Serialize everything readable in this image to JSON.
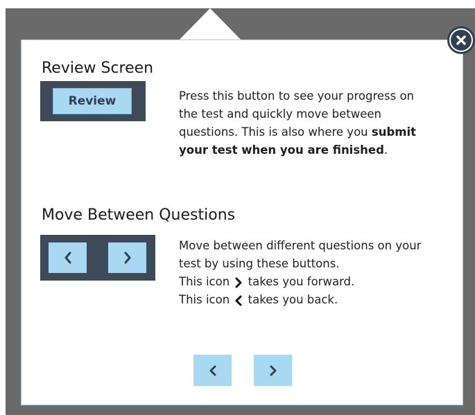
{
  "review_section": {
    "title": "Review Screen",
    "button_label": "Review",
    "description_plain": "Press this button to see your progress on the test and quickly move between questions. This is also where you ",
    "description_bold_1": "submit your test when you are finished",
    "description_tail": "."
  },
  "move_section": {
    "title": "Move Between Questions",
    "line1": "Move between different questions on your test by using these buttons.",
    "line2_prefix": "This icon",
    "line2_suffix": "takes you forward.",
    "line3_prefix": "This icon",
    "line3_suffix": "takes you back."
  },
  "icons": {
    "close": "close-icon",
    "prev": "chevron-left-icon",
    "next": "chevron-right-icon"
  },
  "colors": {
    "backdrop": "#6a6a6a",
    "panel": "#ffffff",
    "dark_bar": "#3e4a57",
    "button_light_blue": "#a8d8f2",
    "icon_dark": "#2f4050"
  }
}
